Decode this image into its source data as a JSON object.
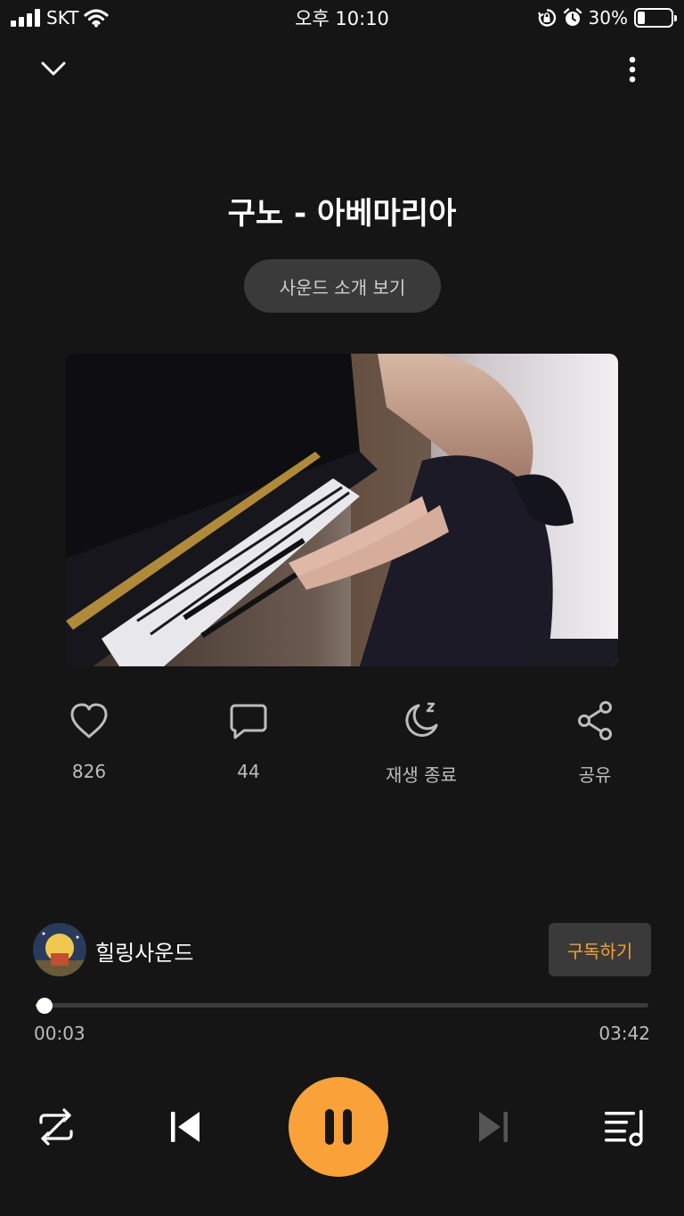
{
  "status_bar": {
    "carrier": "SKT",
    "time": "오후 10:10",
    "battery_text": "30%",
    "battery_level": 0.3
  },
  "header": {
    "collapse_icon": "chevron-down-icon",
    "more_icon": "more-vertical-icon"
  },
  "track": {
    "title": "구노 - 아베마리아",
    "intro_button_label": "사운드 소개 보기"
  },
  "actions": {
    "like": {
      "icon": "heart-icon",
      "label": "826"
    },
    "comment": {
      "icon": "comment-icon",
      "label": "44"
    },
    "sleep_timer": {
      "icon": "moon-sleep-icon",
      "label": "재생 종료"
    },
    "share": {
      "icon": "share-icon",
      "label": "공유"
    }
  },
  "channel": {
    "name": "힐링사운드",
    "subscribe_label": "구독하기"
  },
  "playback": {
    "current_time": "00:03",
    "total_time": "03:42",
    "progress": 0.014
  },
  "controls": {
    "repeat_icon": "repeat-icon",
    "previous_icon": "skip-previous-icon",
    "pause_icon": "pause-icon",
    "next_icon": "skip-next-icon",
    "playlist_icon": "playlist-icon"
  },
  "colors": {
    "background": "#151515",
    "accent": "#f9a23a",
    "button_bg": "#3a3a3a",
    "subscribe_text": "#f4a033",
    "secondary_text": "#bdbdbd"
  }
}
